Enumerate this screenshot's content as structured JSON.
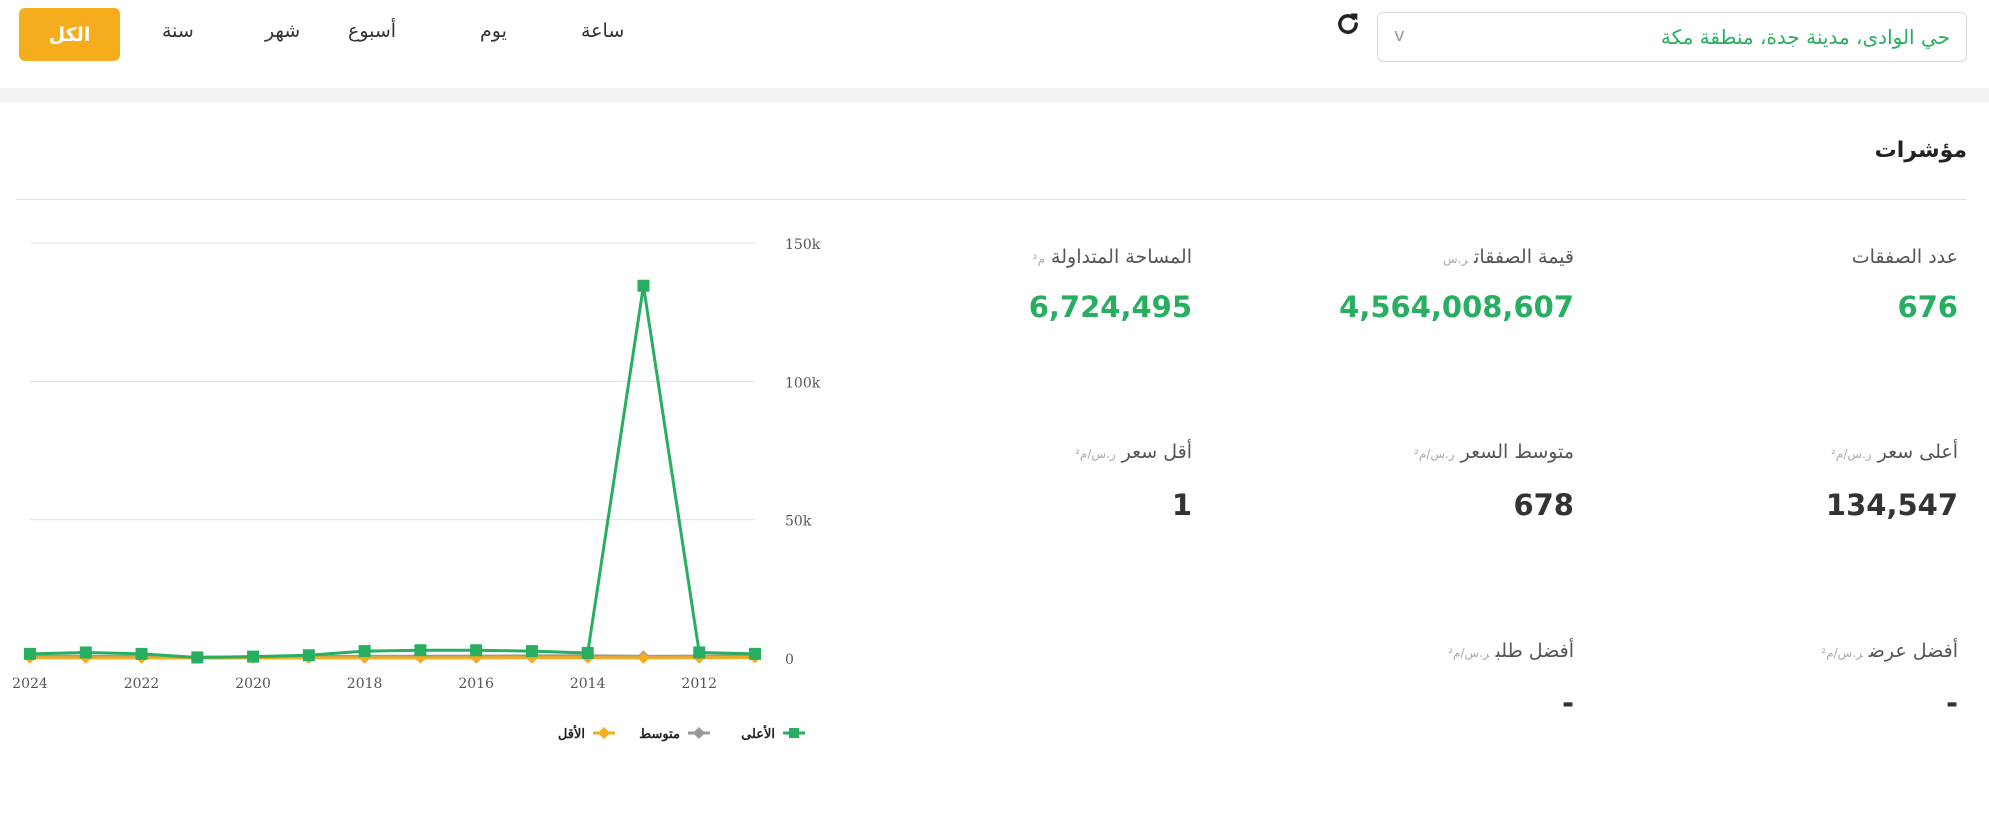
{
  "topbar": {
    "tabs": [
      {
        "key": "hour",
        "label": "ساعة"
      },
      {
        "key": "day",
        "label": "يوم"
      },
      {
        "key": "week",
        "label": "أسبوع"
      },
      {
        "key": "month",
        "label": "شهر"
      },
      {
        "key": "year",
        "label": "سنة"
      }
    ],
    "active_tab": "الكل",
    "location_value": "حي الوادى، مدينة جدة، منطقة مكة",
    "chevron": "v"
  },
  "colors": {
    "accent": "#f5ac1d",
    "green": "#27ae60",
    "gray": "#999999",
    "orange": "#f5ac1d"
  },
  "indicators": {
    "title": "مؤشرات",
    "deals_count": {
      "label": "عدد الصفقات",
      "value": "676"
    },
    "deals_value": {
      "label": "قيمة الصفقات",
      "unit": "ر.س",
      "value": "4,564,008,607"
    },
    "traded_area": {
      "label": "المساحة المتداولة",
      "unit": "م²",
      "value": "6,724,495"
    },
    "highest_price": {
      "label": "أعلى سعر",
      "unit": "ر.س/م²",
      "value": "134,547"
    },
    "avg_price": {
      "label": "متوسط السعر",
      "unit": "ر.س/م²",
      "value": "678"
    },
    "lowest_price": {
      "label": "أقل سعر",
      "unit": "ر.س/م²",
      "value": "1"
    },
    "best_offer": {
      "label": "أفضل عرض",
      "unit": "ر.س/م²",
      "value": "-"
    },
    "best_bid": {
      "label": "أفضل طلب",
      "unit": "ر.س/م²",
      "value": "-"
    }
  },
  "chart_data": {
    "type": "line",
    "x_reversed": true,
    "x": [
      2011,
      2012,
      2013,
      2014,
      2015,
      2016,
      2017,
      2018,
      2019,
      2020,
      2021,
      2022,
      2023,
      2024
    ],
    "x_tick_labels": [
      "2012",
      "2014",
      "2016",
      "2018",
      "2020",
      "2022",
      "2024"
    ],
    "y_ticks": [
      "0",
      "50k",
      "100k",
      "150k"
    ],
    "ylim": [
      0,
      150000
    ],
    "series": [
      {
        "name": "الأعلى",
        "color": "#27ae60",
        "marker": "square",
        "values": [
          1500,
          2000,
          134547,
          1800,
          2500,
          2800,
          2800,
          2500,
          1000,
          500,
          200,
          1500,
          2000,
          1500
        ]
      },
      {
        "name": "متوسط",
        "color": "#999999",
        "marker": "diamond",
        "values": [
          900,
          700,
          600,
          800,
          750,
          700,
          650,
          600,
          500,
          400,
          300,
          500,
          600,
          700
        ]
      },
      {
        "name": "الأقل",
        "color": "#f5ac1d",
        "marker": "diamond",
        "values": [
          200,
          100,
          50,
          100,
          80,
          60,
          50,
          40,
          30,
          20,
          10,
          30,
          50,
          80
        ]
      }
    ]
  }
}
